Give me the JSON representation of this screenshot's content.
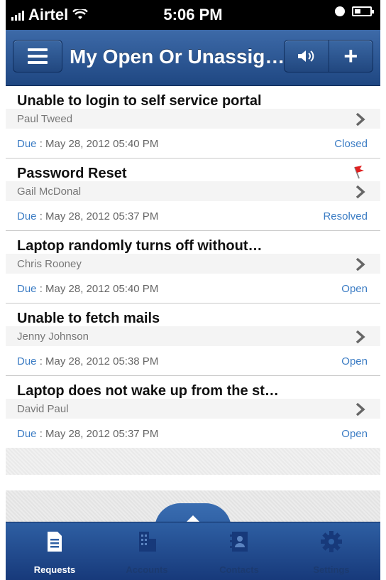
{
  "status_bar": {
    "carrier": "Airtel",
    "time": "5:06 PM"
  },
  "nav": {
    "title": "My Open Or Unassig…",
    "plus_label": "+"
  },
  "requests": [
    {
      "title": "Unable to login to self service portal",
      "requester": "Paul Tweed",
      "due_label": "Due",
      "due": "May 28, 2012 05:40 PM",
      "status": "Closed",
      "flagged": false
    },
    {
      "title": "Password Reset",
      "requester": "Gail McDonal",
      "due_label": "Due",
      "due": "May 28, 2012 05:37 PM",
      "status": "Resolved",
      "flagged": true
    },
    {
      "title": "Laptop randomly turns off without…",
      "requester": "Chris Rooney",
      "due_label": "Due",
      "due": "May 28, 2012 05:40 PM",
      "status": "Open",
      "flagged": false
    },
    {
      "title": "Unable to fetch mails",
      "requester": "Jenny Johnson",
      "due_label": "Due",
      "due": "May 28, 2012 05:38 PM",
      "status": "Open",
      "flagged": false
    },
    {
      "title": "Laptop does not wake up from the st…",
      "requester": "David Paul",
      "due_label": "Due",
      "due": "May 28, 2012 05:37 PM",
      "status": "Open",
      "flagged": false
    }
  ],
  "tabs": [
    {
      "label": "Requests",
      "icon": "document-icon",
      "active": true
    },
    {
      "label": "Accounts",
      "icon": "building-icon",
      "active": false
    },
    {
      "label": "Contacts",
      "icon": "contact-book-icon",
      "active": false
    },
    {
      "label": "Settings",
      "icon": "gear-icon",
      "active": false
    }
  ],
  "colors": {
    "nav": "#2e5fa3",
    "link": "#3b7cc4"
  }
}
